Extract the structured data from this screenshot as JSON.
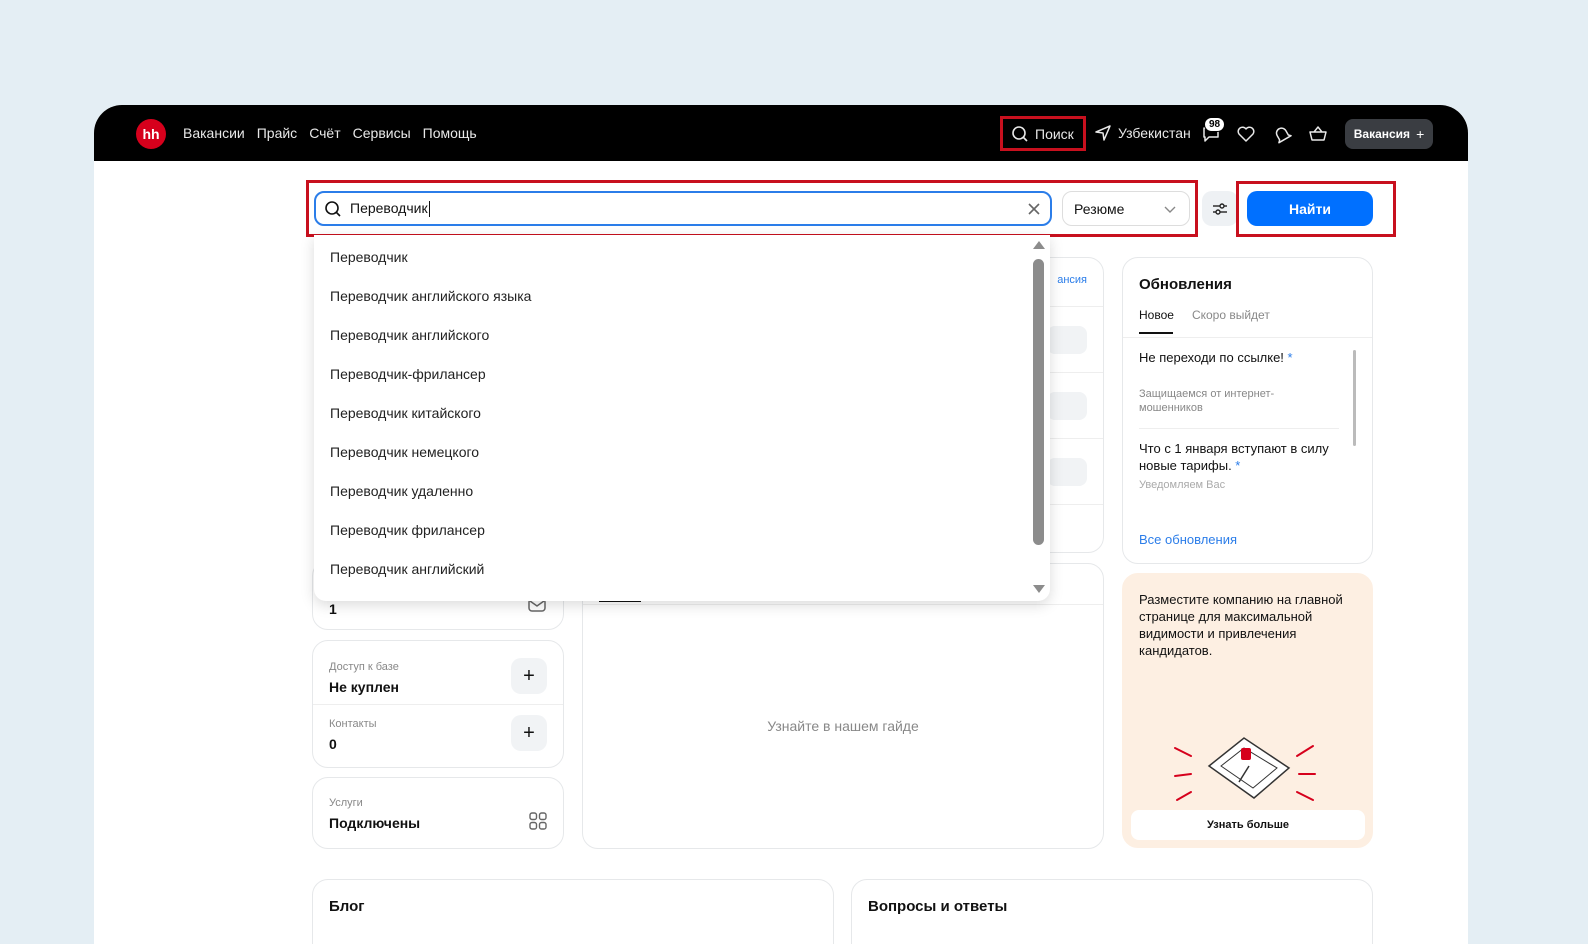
{
  "topbar": {
    "logo": "hh",
    "nav": [
      "Вакансии",
      "Прайс",
      "Счёт",
      "Сервисы",
      "Помощь"
    ],
    "search_label": "Поиск",
    "region": "Узбекистан",
    "messages_badge": "98",
    "vacancy_button": "Вакансия",
    "vacancy_plus": "+"
  },
  "search": {
    "query": "Переводчик",
    "type_select": "Резюме",
    "find_button": "Найти"
  },
  "suggestions": [
    "Переводчик",
    "Переводчик английского языка",
    "Переводчик английского",
    "Переводчик-фрилансер",
    "Переводчик китайского",
    "Переводчик немецкого",
    "Переводчик удаленно",
    "Переводчик фрилансер",
    "Переводчик английский"
  ],
  "middle": {
    "vacancy_link": "ансия",
    "guide_text": "Узнайте в нашем гайде"
  },
  "left": {
    "partial_value": "1",
    "db_access_label": "Доступ к базе",
    "db_access_value": "Не куплен",
    "contacts_label": "Контакты",
    "contacts_value": "0",
    "services_label": "Услуги",
    "services_value": "Подключены"
  },
  "updates": {
    "title": "Обновления",
    "tab_new": "Новое",
    "tab_soon": "Скоро выйдет",
    "items": [
      {
        "title": "Не переходи по ссылке!",
        "desc": "Защищаемся от интернет-мошенников"
      },
      {
        "title": "Что с 1 января вступают в силу новые тарифы.",
        "desc": "Уведомляем Вас"
      }
    ],
    "all_link": "Все обновления"
  },
  "promo": {
    "text": "Разместите компанию на главной странице для максимальной видимости и привлечения кандидатов.",
    "button": "Узнать больше"
  },
  "bottom": {
    "blog": "Блог",
    "faq": "Вопросы и ответы"
  },
  "colors": {
    "brand_red": "#d6001c",
    "accent_blue": "#0070ff",
    "highlight_red": "#c8101e"
  }
}
